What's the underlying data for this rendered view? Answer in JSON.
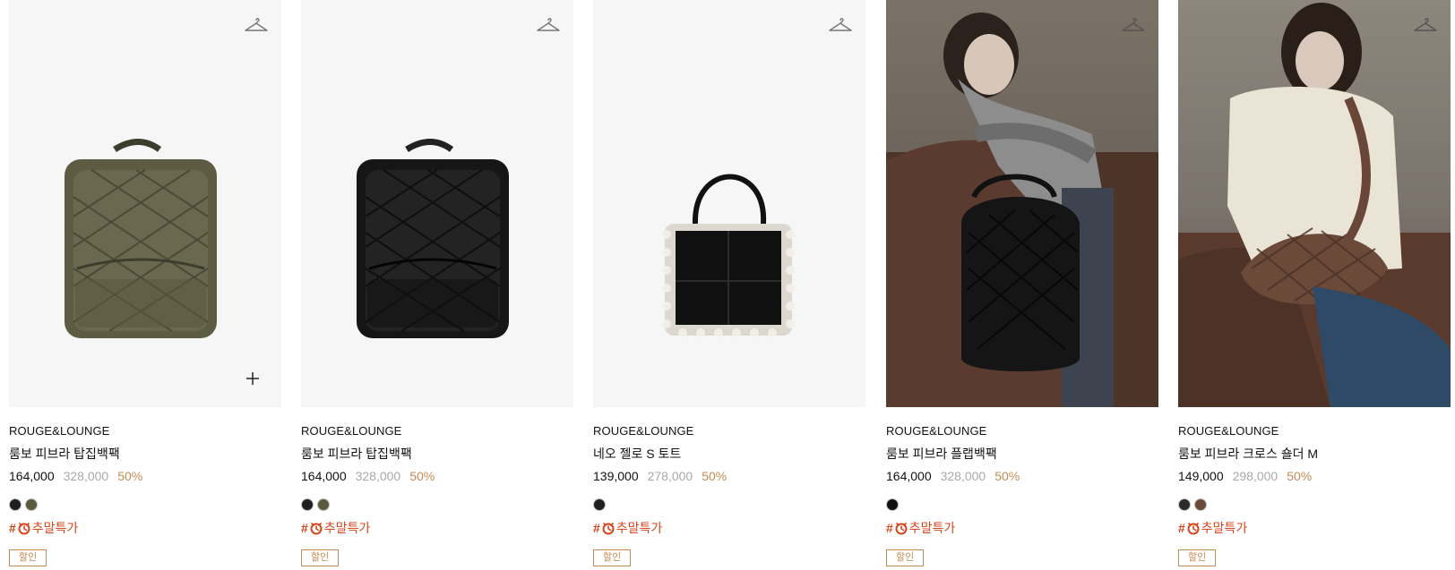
{
  "products": [
    {
      "brand": "ROUGE&LOUNGE",
      "name": "룸보 피브라 탑집백팩",
      "sale_price": "164,000",
      "original_price": "328,000",
      "discount": "50%",
      "swatches": [
        "#1f1f1f",
        "#5c5a3d"
      ],
      "tag_hash": "#",
      "tag_label": "추말특가",
      "badge": "할인",
      "icon": "hanger-icon",
      "visual": "olive-quilted-backpack"
    },
    {
      "brand": "ROUGE&LOUNGE",
      "name": "룸보 피브라 탑집백팩",
      "sale_price": "164,000",
      "original_price": "328,000",
      "discount": "50%",
      "swatches": [
        "#1f1f1f",
        "#5c5a3d"
      ],
      "tag_hash": "#",
      "tag_label": "추말특가",
      "badge": "할인",
      "icon": "hanger-icon",
      "visual": "black-quilted-backpack"
    },
    {
      "brand": "ROUGE&LOUNGE",
      "name": "네오 젤로 S 토트",
      "sale_price": "139,000",
      "original_price": "278,000",
      "discount": "50%",
      "swatches": [
        "#1f1f1f"
      ],
      "tag_hash": "#",
      "tag_label": "추말특가",
      "badge": "할인",
      "icon": "hanger-icon",
      "visual": "black-tote-shearling"
    },
    {
      "brand": "ROUGE&LOUNGE",
      "name": "룸보 피브라 플랩백팩",
      "sale_price": "164,000",
      "original_price": "328,000",
      "discount": "50%",
      "swatches": [
        "#111111"
      ],
      "tag_hash": "#",
      "tag_label": "추말특가",
      "badge": "할인",
      "icon": "hanger-icon",
      "visual": "model-black-flap-backpack"
    },
    {
      "brand": "ROUGE&LOUNGE",
      "name": "룸보 피브라 크로스 숄더 M",
      "sale_price": "149,000",
      "original_price": "298,000",
      "discount": "50%",
      "swatches": [
        "#2b2b2b",
        "#6b4a3a"
      ],
      "tag_hash": "#",
      "tag_label": "추말특가",
      "badge": "할인",
      "icon": "hanger-icon",
      "visual": "model-brown-cross-shoulder"
    }
  ],
  "colors": {
    "discount": "#c58b54",
    "tag": "#d5461d",
    "original_price": "#a9a9a9"
  }
}
